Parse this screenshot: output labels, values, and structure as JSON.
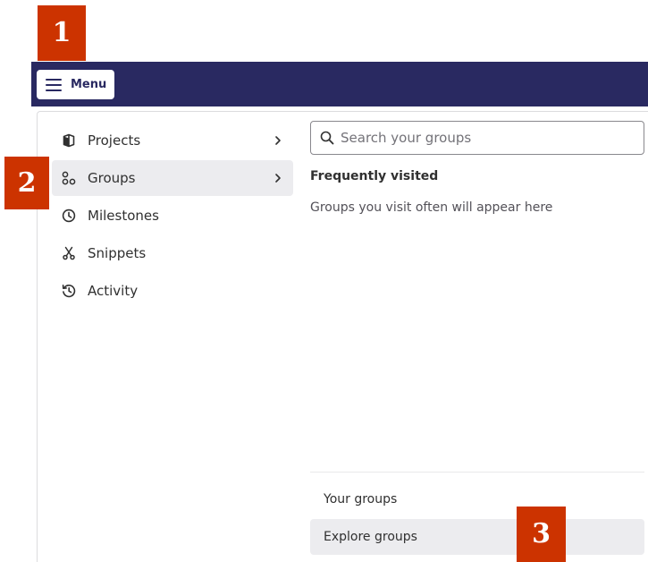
{
  "markers": {
    "step1": "1",
    "step2": "2",
    "step3": "3"
  },
  "topbar": {
    "menu_label": "Menu"
  },
  "nav": {
    "items": [
      {
        "label": "Projects",
        "icon": "project-icon",
        "has_chevron": true
      },
      {
        "label": "Groups",
        "icon": "group-icon",
        "has_chevron": true,
        "active": true
      },
      {
        "label": "Milestones",
        "icon": "clock-icon"
      },
      {
        "label": "Snippets",
        "icon": "scissors-icon"
      },
      {
        "label": "Activity",
        "icon": "history-icon"
      }
    ]
  },
  "groups_panel": {
    "search_placeholder": "Search your groups",
    "frequent_title": "Frequently visited",
    "frequent_empty": "Groups you visit often will appear here",
    "links": {
      "your_groups": "Your groups",
      "explore_groups": "Explore groups"
    }
  },
  "colors": {
    "topbar": "#292961",
    "marker": "#cc3300",
    "active_bg": "#ececef"
  }
}
